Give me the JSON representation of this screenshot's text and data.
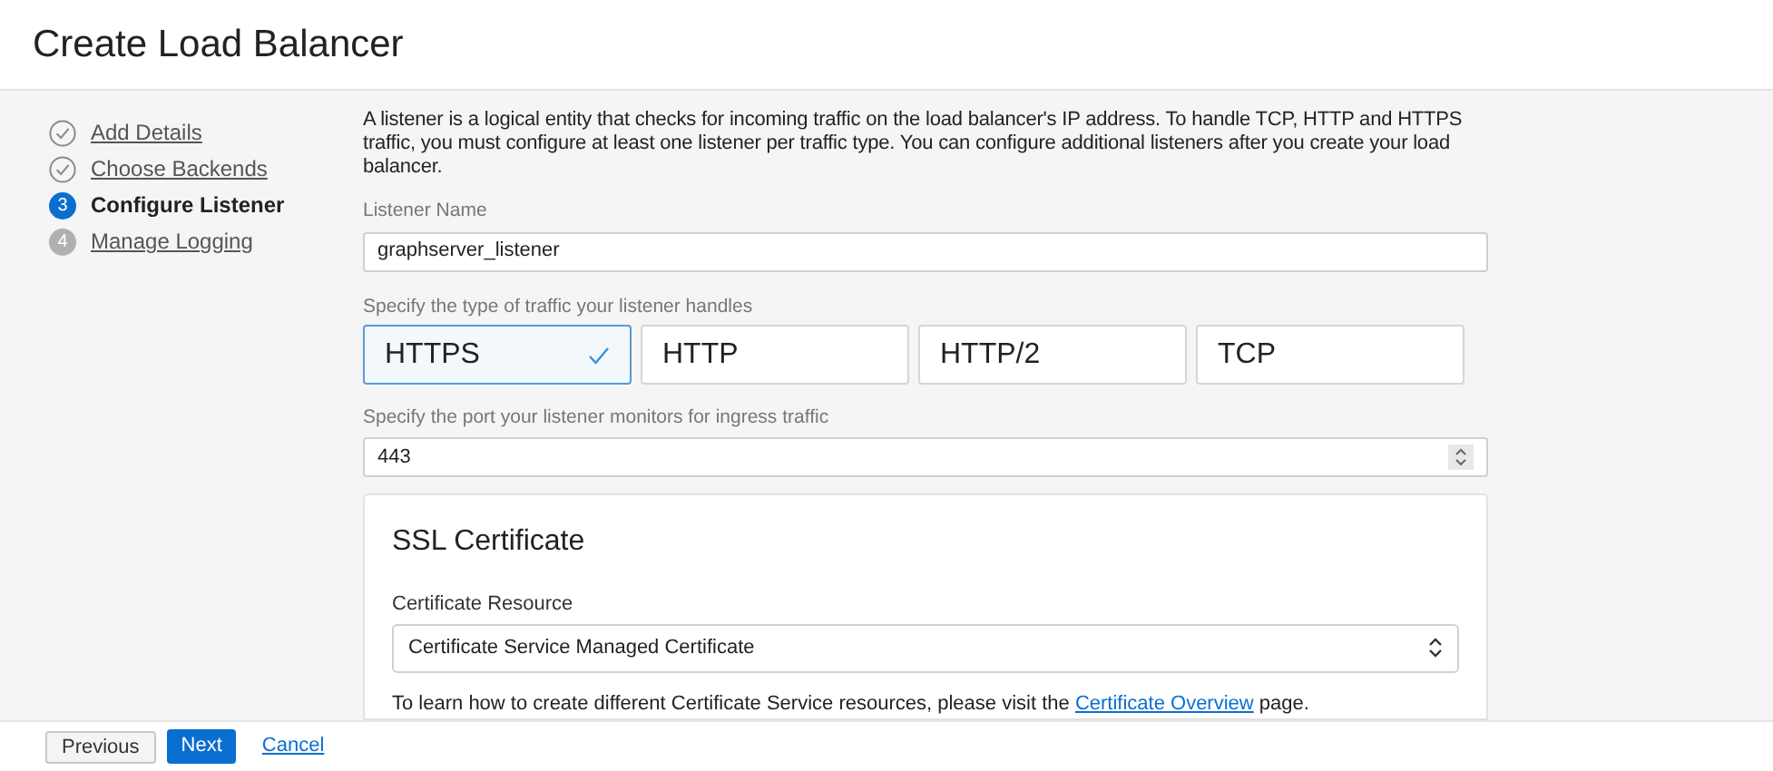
{
  "page_title": "Create Load Balancer",
  "steps": [
    {
      "kind": "done",
      "label": "Add Details"
    },
    {
      "kind": "done",
      "label": "Choose Backends"
    },
    {
      "kind": "current",
      "number": "3",
      "label": "Configure Listener"
    },
    {
      "kind": "pending",
      "number": "4",
      "label": "Manage Logging"
    }
  ],
  "description": "A listener is a logical entity that checks for incoming traffic on the load balancer's IP address. To handle TCP, HTTP and HTTPS traffic, you must configure at least one listener per traffic type. You can configure additional listeners after you create your load balancer.",
  "listener_name": {
    "label": "Listener Name",
    "value": "graphserver_listener"
  },
  "traffic": {
    "label": "Specify the type of traffic your listener handles",
    "options": [
      {
        "label": "HTTPS",
        "selected": true
      },
      {
        "label": "HTTP",
        "selected": false
      },
      {
        "label": "HTTP/2",
        "selected": false
      },
      {
        "label": "TCP",
        "selected": false
      }
    ]
  },
  "port": {
    "label": "Specify the port your listener monitors for ingress traffic",
    "value": "443"
  },
  "ssl": {
    "title": "SSL Certificate",
    "resource_label": "Certificate Resource",
    "resource_value": "Certificate Service Managed Certificate",
    "help_before": "To learn how to create different Certificate Service resources, please visit the",
    "help_link": "Certificate Overview",
    "help_after": "page."
  },
  "footer": {
    "previous": "Previous",
    "next": "Next",
    "cancel": "Cancel"
  }
}
